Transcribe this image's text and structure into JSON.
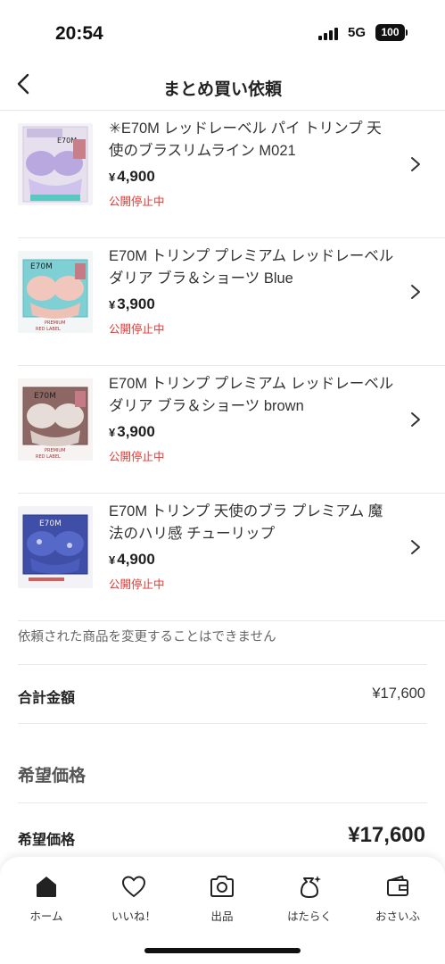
{
  "status": {
    "time": "20:54",
    "network": "5G",
    "battery": "100"
  },
  "nav": {
    "title": "まとめ買い依頼"
  },
  "products": [
    {
      "title": "✳E70M レッドレーベル パイ トリンプ 天使のブラスリムライン M021",
      "yen": "¥",
      "price": "4,900",
      "status": "公開停止中"
    },
    {
      "title": "E70M トリンプ プレミアム レッドレーベル ダリア ブラ＆ショーツ Blue",
      "yen": "¥",
      "price": "3,900",
      "status": "公開停止中"
    },
    {
      "title": "E70M トリンプ プレミアム レッドレーベル ダリア ブラ＆ショーツ brown",
      "yen": "¥",
      "price": "3,900",
      "status": "公開停止中"
    },
    {
      "title": "E70M トリンプ 天使のブラ プレミアム 魔法のハリ感 チューリップ",
      "yen": "¥",
      "price": "4,900",
      "status": "公開停止中"
    }
  ],
  "notice": "依頼された商品を変更することはできません",
  "total": {
    "label": "合計金額",
    "value": "¥17,600"
  },
  "desired": {
    "section_title": "希望価格",
    "label": "希望価格",
    "value": "¥17,600"
  },
  "tabs": [
    {
      "label": "ホーム",
      "icon": "home-icon"
    },
    {
      "label": "いいね！",
      "icon": "heart-icon"
    },
    {
      "label": "出品",
      "icon": "camera-icon"
    },
    {
      "label": "はたらく",
      "icon": "bag-sparkle-icon"
    },
    {
      "label": "おさいふ",
      "icon": "wallet-icon"
    }
  ],
  "colors": {
    "status_red": "#e8342f",
    "text": "#222222",
    "divider": "#e9e9e9"
  }
}
